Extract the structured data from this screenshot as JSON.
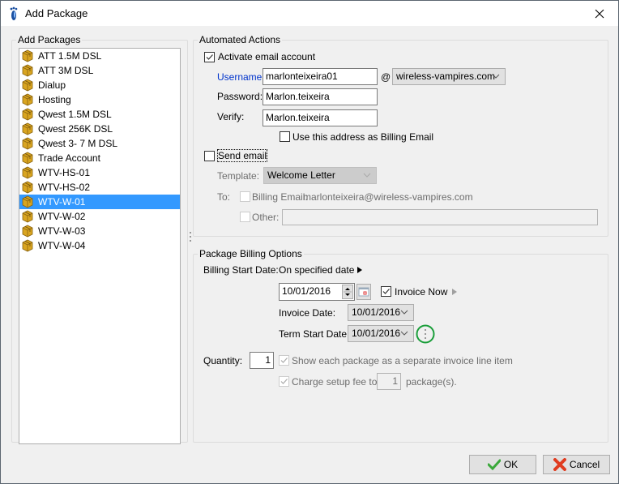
{
  "window": {
    "title": "Add Package",
    "close_icon": "close-icon",
    "app_icon": "footprint-icon"
  },
  "packages": {
    "group_title": "Add Packages",
    "icon": "package-box-icon",
    "items": [
      {
        "label": "ATT 1.5M DSL",
        "selected": false
      },
      {
        "label": "ATT 3M DSL",
        "selected": false
      },
      {
        "label": "Dialup",
        "selected": false
      },
      {
        "label": "Hosting",
        "selected": false
      },
      {
        "label": "Qwest 1.5M DSL",
        "selected": false
      },
      {
        "label": "Qwest 256K DSL",
        "selected": false
      },
      {
        "label": "Qwest 3- 7 M DSL",
        "selected": false
      },
      {
        "label": "Trade Account",
        "selected": false
      },
      {
        "label": "WTV-HS-01",
        "selected": false
      },
      {
        "label": "WTV-HS-02",
        "selected": false
      },
      {
        "label": "WTV-W-01",
        "selected": true
      },
      {
        "label": "WTV-W-02",
        "selected": false
      },
      {
        "label": "WTV-W-03",
        "selected": false
      },
      {
        "label": "WTV-W-04",
        "selected": false
      }
    ]
  },
  "automated_actions": {
    "group_title": "Automated Actions",
    "activate_email": {
      "label": "Activate email account",
      "checked": true
    },
    "username": {
      "label": "Username:",
      "value": "marlonteixeira01"
    },
    "at_sign": "@",
    "domain": {
      "value": "wireless-vampires.com"
    },
    "password": {
      "label": "Password:",
      "value": "Marlon.teixeira"
    },
    "verify": {
      "label": "Verify:",
      "value": "Marlon.teixeira"
    },
    "use_as_billing": {
      "label": "Use this address as Billing Email",
      "checked": false
    },
    "send_email": {
      "label": "Send email",
      "checked": false
    },
    "template": {
      "label": "Template:",
      "value": "Welcome Letter"
    },
    "to_label": "To:",
    "billing_email": {
      "label": "Billing Email:",
      "value": "marlonteixeira@wireless-vampires.com",
      "checked": false
    },
    "other": {
      "label": "Other:",
      "value": "",
      "checked": false
    }
  },
  "billing_options": {
    "group_title": "Package Billing Options",
    "billing_start": {
      "label": "Billing Start Date:",
      "value": "On specified date"
    },
    "start_date": {
      "value": "10/01/2016"
    },
    "invoice_now": {
      "label": "Invoice Now",
      "checked": true
    },
    "invoice_date": {
      "label": "Invoice Date:",
      "value": "10/01/2016"
    },
    "term_start_date": {
      "label": "Term Start Date:",
      "value": "10/01/2016"
    },
    "quantity": {
      "label": "Quantity:",
      "value": "1"
    },
    "separate_line_item": {
      "label": "Show each package as a separate invoice line item",
      "checked": true
    },
    "charge_setup": {
      "label": "Charge setup fee to",
      "value": "1",
      "suffix": "package(s).",
      "checked": true
    },
    "highlight_color": "#1a9e3a"
  },
  "buttons": {
    "ok": "OK",
    "cancel": "Cancel"
  }
}
